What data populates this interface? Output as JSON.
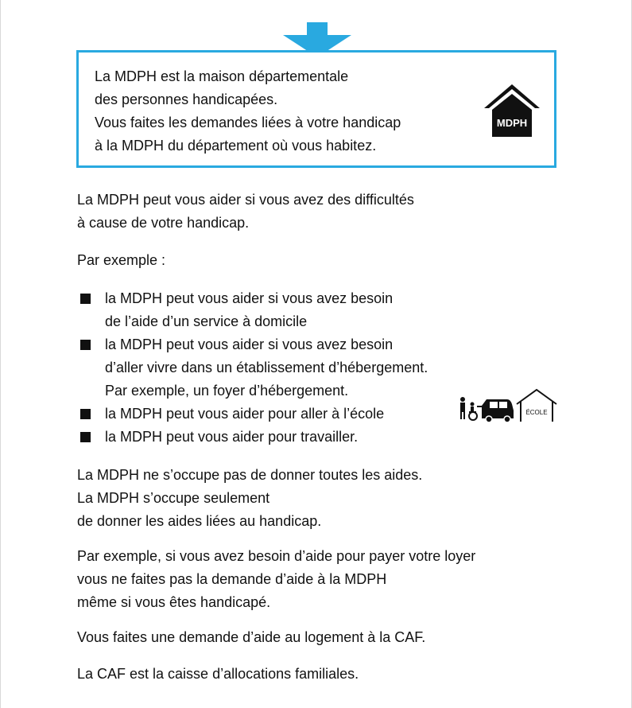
{
  "callout": {
    "lines": [
      "La MDPH est la maison départementale",
      "des personnes handicapées.",
      "Vous faites les demandes liées à votre handicap",
      "à la MDPH du département où vous habitez."
    ],
    "house_label": "MDPH",
    "border_color": "#29a9e0"
  },
  "intro": {
    "lines": [
      "La MDPH peut vous aider si vous avez des difficultés",
      "à cause de votre handicap."
    ]
  },
  "example_label": "Par exemple :",
  "list": [
    {
      "lines": [
        "la MDPH peut vous aider si vous avez besoin",
        "de l’aide d’un service à domicile"
      ]
    },
    {
      "lines": [
        "la MDPH peut vous aider si vous avez besoin",
        "d’aller vivre dans un établissement d’hébergement.",
        "Par exemple, un foyer d’hébergement."
      ]
    },
    {
      "lines": [
        "la MDPH peut vous aider pour aller à l’école"
      ]
    },
    {
      "lines": [
        "la MDPH peut vous aider pour travailler."
      ]
    }
  ],
  "illustration": {
    "school_label": "ÉCOLE"
  },
  "paragraph3": {
    "lines": [
      "La MDPH ne s’occupe pas de donner toutes les aides.",
      "La MDPH s’occupe seulement",
      "de donner les aides liées au handicap."
    ]
  },
  "paragraph4": {
    "lines": [
      "Par exemple, si vous avez besoin d’aide pour payer votre loyer",
      "vous ne faites pas la demande d’aide à la MDPH",
      "même si vous êtes handicapé."
    ]
  },
  "paragraph5": {
    "lines": [
      "Vous faites une demande d’aide au logement à la CAF."
    ]
  },
  "paragraph6": {
    "lines": [
      "La CAF est la caisse d’allocations familiales."
    ]
  }
}
